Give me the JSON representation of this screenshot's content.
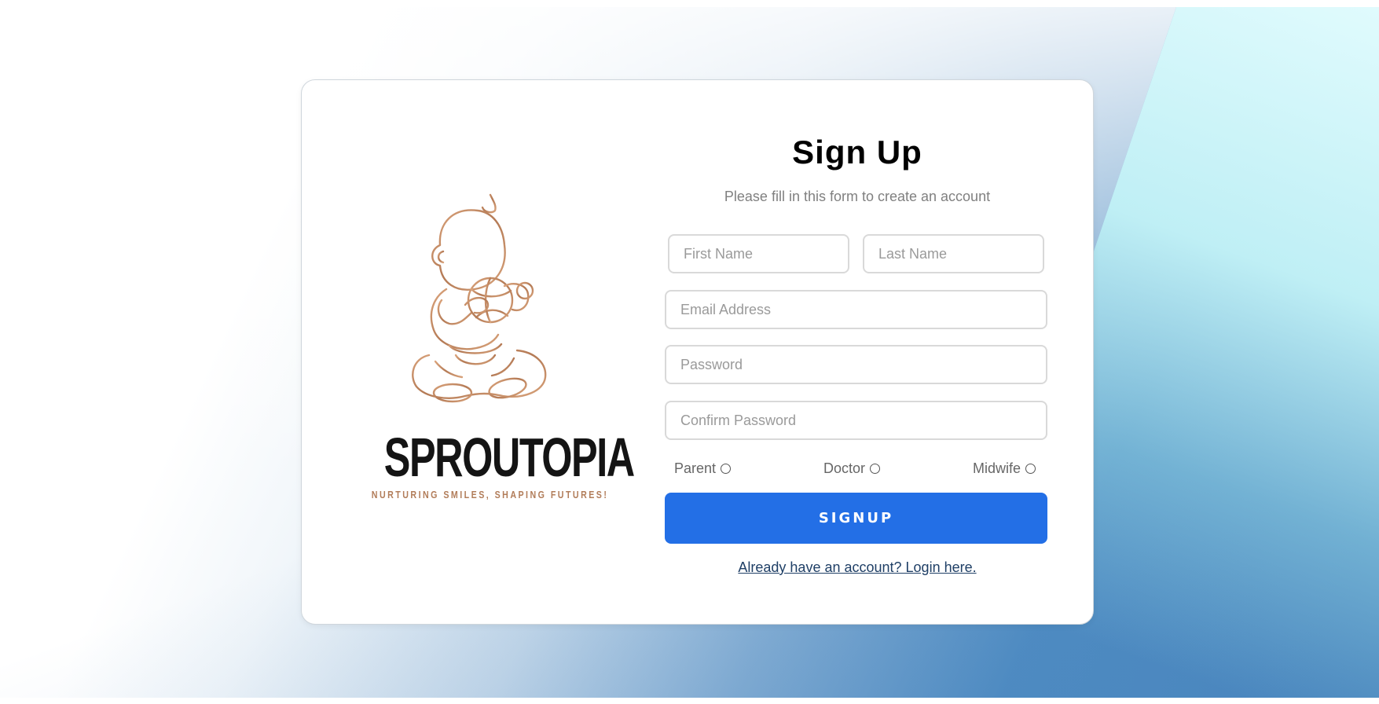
{
  "brand": {
    "name": "SPROUTOPIA",
    "tagline": "NURTURING SMILES, SHAPING FUTURES!",
    "logo_icon": "baby-with-ball-icon"
  },
  "form": {
    "title": "Sign Up",
    "subtitle": "Please fill in this form to create an account",
    "first_name_placeholder": "First Name",
    "last_name_placeholder": "Last Name",
    "email_placeholder": "Email Address",
    "password_placeholder": "Password",
    "confirm_password_placeholder": "Confirm Password",
    "roles": [
      "Parent",
      "Doctor",
      "Midwife"
    ],
    "submit_label": "SIGNUP",
    "login_link": "Already have an account? Login here."
  },
  "colors": {
    "primary_button": "#236fe6",
    "logo_outline": "#c08a63",
    "link": "#1f3f66"
  }
}
